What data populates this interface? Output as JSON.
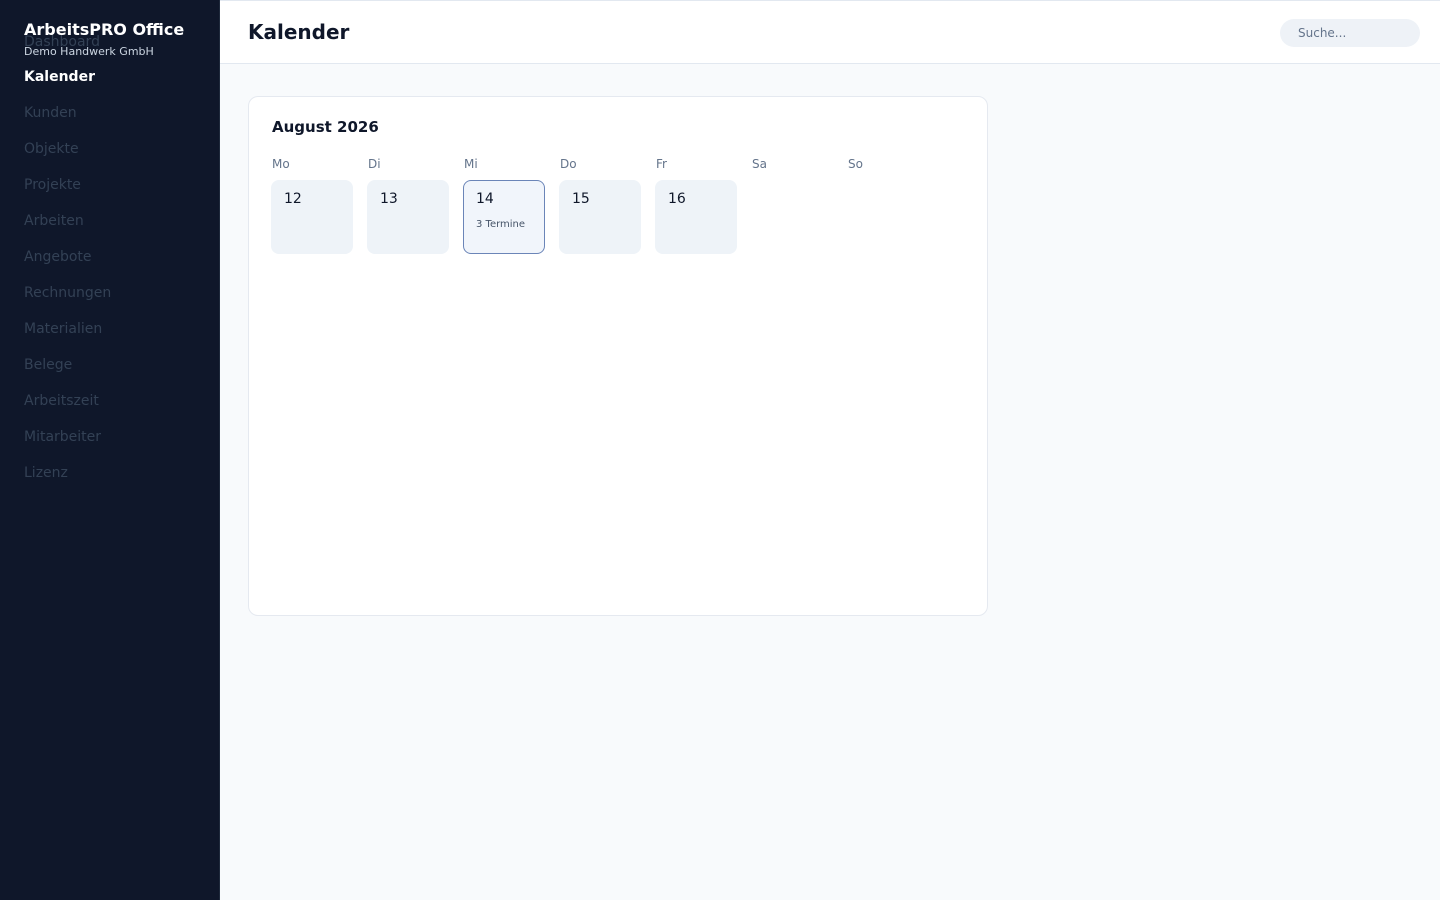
{
  "app": {
    "title": "ArbeitsPRO Office",
    "company": "Demo Handwerk GmbH"
  },
  "sidebar": {
    "items": [
      {
        "label": "Dashboard",
        "active": false
      },
      {
        "label": "Kalender",
        "active": true
      },
      {
        "label": "Kunden",
        "active": false
      },
      {
        "label": "Objekte",
        "active": false
      },
      {
        "label": "Projekte",
        "active": false
      },
      {
        "label": "Arbeiten",
        "active": false
      },
      {
        "label": "Angebote",
        "active": false
      },
      {
        "label": "Rechnungen",
        "active": false
      },
      {
        "label": "Materialien",
        "active": false
      },
      {
        "label": "Belege",
        "active": false
      },
      {
        "label": "Arbeitszeit",
        "active": false
      },
      {
        "label": "Mitarbeiter",
        "active": false
      },
      {
        "label": "Lizenz",
        "active": false
      }
    ]
  },
  "header": {
    "title": "Kalender",
    "search_placeholder": "Suche..."
  },
  "calendar": {
    "month": "August 2026",
    "weekdays": [
      "Mo",
      "Di",
      "Mi",
      "Do",
      "Fr",
      "Sa",
      "So"
    ],
    "days": [
      {
        "num": "12",
        "events": "",
        "selected": false
      },
      {
        "num": "13",
        "events": "",
        "selected": false
      },
      {
        "num": "14",
        "events": "3 Termine",
        "selected": true
      },
      {
        "num": "15",
        "events": "",
        "selected": false
      },
      {
        "num": "16",
        "events": "",
        "selected": false
      }
    ]
  },
  "colors": {
    "sidebar_bg": "#0f172a",
    "accent_border": "#6b85b8",
    "cell_bg": "#eef3f8"
  }
}
